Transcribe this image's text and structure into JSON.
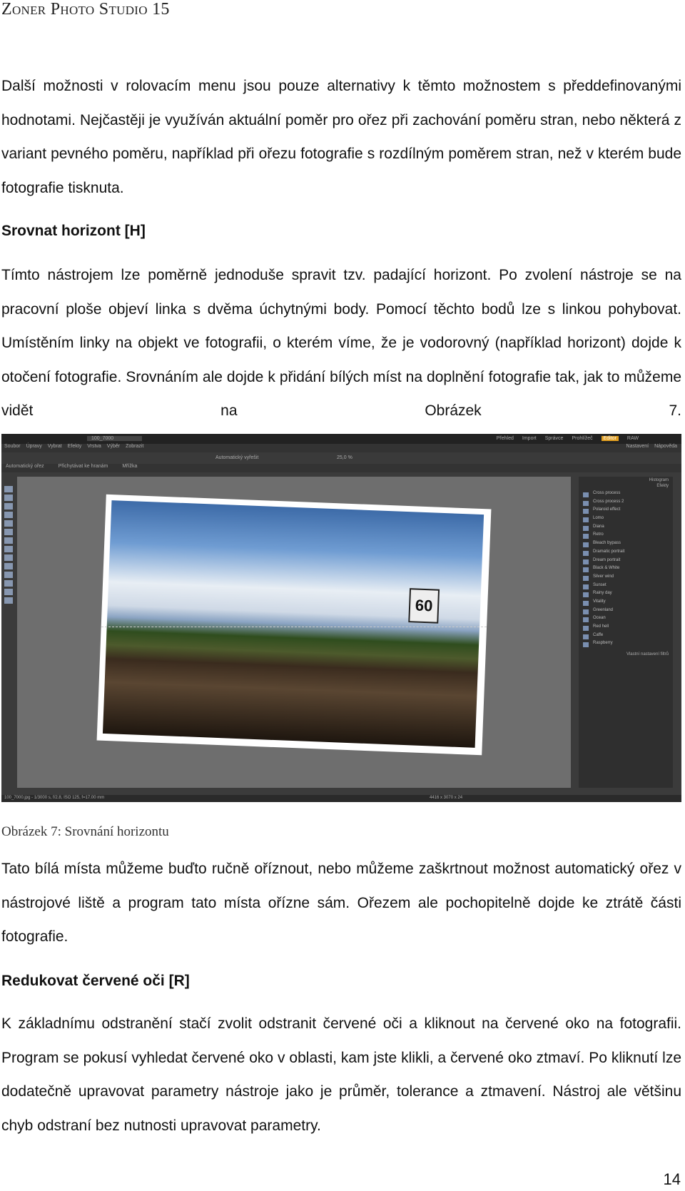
{
  "header": "Zoner Photo Studio 15",
  "paragraphs": {
    "p1": "Další možnosti v rolovacím menu jsou pouze alternativy k těmto možnostem s předdefinovanými hodnotami. Nejčastěji je využíván aktuální poměr pro ořez při zachování poměru stran, nebo některá z variant pevného poměru, například při ořezu fotografie s rozdílným poměrem stran, než v kterém bude fotografie tisknuta.",
    "h1": "Srovnat horizont [H]",
    "p2": "Tímto nástrojem lze poměrně jednoduše spravit tzv. padající horizont. Po zvolení nástroje se na pracovní ploše objeví linka s dvěma úchytnými body. Pomocí těchto bodů lze s linkou pohybovat. Umístěním linky na objekt ve fotografii, o kterém víme, že je vodorovný (například horizont) dojde k otočení fotografie. Srovnáním ale dojde k přidání bílých míst na doplnění fotografie tak, jak to můžeme vidět na Obrázek 7.",
    "caption": "Obrázek 7: Srovnání horizontu",
    "p3": "Tato bílá místa můžeme buďto ručně oříznout, nebo můžeme zaškrtnout možnost automatický ořez v nástrojové liště a program tato místa ořízne sám. Ořezem ale pochopitelně dojde ke ztrátě části fotografie.",
    "h2": "Redukovat červené oči [R]",
    "p4": "K základnímu odstranění stačí zvolit odstranit červené oči a kliknout na červené oko na fotografii. Program se pokusí vyhledat červené oko v oblasti, kam jste klikli, a červené oko ztmaví. Po kliknutí lze dodatečně upravovat parametry nástroje jako je průměr, tolerance a ztmavení. Nástroj ale většinu chyb odstraní bez nutnosti upravovat parametry."
  },
  "screenshot": {
    "doc_tab": "100_7000",
    "modules": [
      "Přehled",
      "Import",
      "Správce",
      "Prohlížeč",
      "Editor",
      "RAW"
    ],
    "menu": [
      "Soubor",
      "Úpravy",
      "Vybrat",
      "Efekty",
      "Vrstva",
      "Výběr",
      "Zobrazit"
    ],
    "right_buttons": [
      "Nastavení",
      "Nápověda"
    ],
    "toolbar_item": "Automatický vyřešit",
    "zoom": "25,0 %",
    "options": [
      "Automatický ořez",
      "Přichytávat ke hranám",
      "Mřížka"
    ],
    "panel_headers": [
      "Histogram",
      "Efekty"
    ],
    "effects": [
      "Cross process",
      "Cross process 2",
      "Polaroid effect",
      "Lomo",
      "Diana",
      "Retro",
      "Bleach bypass",
      "Dramatic portrait",
      "Dream portrait",
      "Black & White",
      "Silver wind",
      "Sunset",
      "Rainy day",
      "Vitality",
      "Greenland",
      "Ocean",
      "Red hell",
      "Caffe",
      "Raspberry"
    ],
    "panel_footer": "Vlastní nastavení filtrů",
    "sign_text": "60",
    "status": "100_7000.jpg - 1/3000 s, f/2.8, ISO 125, f=17.00 mm",
    "dims": "4416 x 3070 x 24"
  },
  "page_number": "14"
}
